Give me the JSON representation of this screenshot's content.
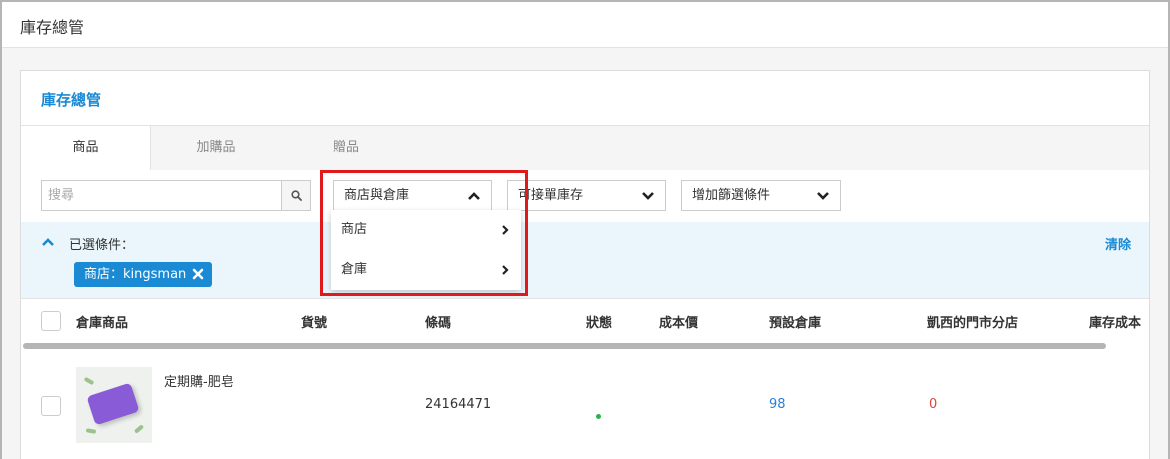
{
  "page": {
    "title": "庫存總管"
  },
  "card": {
    "title": "庫存總管"
  },
  "tabs": [
    {
      "label": "商品",
      "active": true
    },
    {
      "label": "加購品",
      "active": false
    },
    {
      "label": "贈品",
      "active": false
    }
  ],
  "filters": {
    "search_placeholder": "搜尋",
    "selects": [
      {
        "label": "商店與倉庫",
        "open": true
      },
      {
        "label": "可接單庫存",
        "open": false
      },
      {
        "label": "增加篩選條件",
        "open": false
      }
    ],
    "dropdown_items": [
      {
        "label": "商店"
      },
      {
        "label": "倉庫"
      }
    ]
  },
  "selected_conditions": {
    "label": "已選條件：",
    "chips": [
      {
        "label": "商店：kingsman"
      }
    ],
    "clear_label": "清除"
  },
  "table": {
    "columns": [
      "倉庫商品",
      "貨號",
      "條碼",
      "狀態",
      "成本價",
      "預設倉庫",
      "凱西的門市分店",
      "庫存成本"
    ],
    "rows": [
      {
        "name": "定期購-肥皂",
        "sku": "",
        "barcode": "24164471",
        "status": "active",
        "cost": "",
        "default_warehouse": "98",
        "kathy_store": "0"
      }
    ]
  },
  "colors": {
    "accent": "#1a8ad4",
    "highlight": "#e01a1a",
    "status_active": "#2bb24c",
    "negative": "#e0443a",
    "link_value": "#2a7fd4"
  }
}
